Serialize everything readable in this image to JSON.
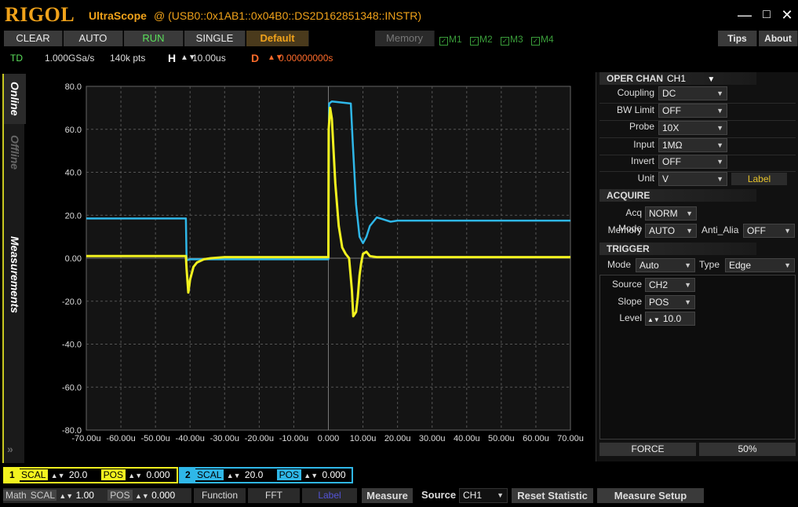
{
  "title": {
    "logo": "RIGOL",
    "app": "UltraScope",
    "instrument": "@ (USB0::0x1AB1::0x04B0::DS2D162851348::INSTR)"
  },
  "window_controls": {
    "minimize": "—",
    "maximize": "□",
    "close": "✕"
  },
  "toolbar": {
    "clear": "CLEAR",
    "auto": "AUTO",
    "run": "RUN",
    "single": "SINGLE",
    "default": "Default",
    "memory": "Memory",
    "m1": "M1",
    "m2": "M2",
    "m3": "M3",
    "m4": "M4",
    "tips": "Tips",
    "about": "About"
  },
  "info": {
    "td": "TD",
    "sample_rate": "1.000GSa/s",
    "points": "140k pts",
    "h_label": "H",
    "h_value": "10.00us",
    "d_label": "D",
    "d_value": "0.00000000s"
  },
  "left_tabs": {
    "online": "Online",
    "offline": "Offline",
    "measurements": "Measurements"
  },
  "chart_data": {
    "type": "line",
    "x_unit": "us",
    "xlim": [
      -70,
      70
    ],
    "ylim": [
      -80,
      80
    ],
    "grid": true,
    "x_ticks": [
      "-70.00u",
      "-60.00u",
      "-50.00u",
      "-40.00u",
      "-30.00u",
      "-20.00u",
      "-10.00u",
      "0.000",
      "10.00u",
      "20.00u",
      "30.00u",
      "40.00u",
      "50.00u",
      "60.00u",
      "70.00u"
    ],
    "y_ticks": [
      "80.0",
      "60.0",
      "40.0",
      "20.0",
      "0.00",
      "-20.0",
      "-40.0",
      "-60.0",
      "-80.0"
    ],
    "series": [
      {
        "color": "#2fb7e8",
        "x": [
          -70,
          -41.2,
          -41,
          -40,
          0,
          0.2,
          1,
          6.5,
          7,
          8,
          9,
          10,
          11,
          12,
          14,
          16,
          18,
          20,
          70
        ],
        "y": [
          18.5,
          18.5,
          -1,
          -0.5,
          -0.5,
          72,
          73,
          72,
          55,
          25,
          10,
          7,
          10,
          15,
          19,
          18,
          17,
          17.5,
          17.5
        ]
      },
      {
        "color": "#f2f21f",
        "x": [
          -70,
          -41.2,
          -41,
          -40.5,
          -40,
          -39,
          -38,
          -36,
          -34,
          -30,
          0,
          0.1,
          0.5,
          1,
          2,
          3,
          4,
          5,
          6,
          6.8,
          7.2,
          8,
          8.5,
          9,
          9.5,
          10,
          11,
          12,
          14,
          16,
          20,
          70
        ],
        "y": [
          1,
          1,
          -5,
          -16,
          -10,
          -4,
          -2,
          -0.5,
          0,
          0.5,
          0.5,
          60,
          70,
          65,
          35,
          15,
          5,
          2,
          0,
          -15,
          -27,
          -25,
          -18,
          -8,
          -2,
          2,
          3,
          1,
          0.5,
          0.5,
          0.5,
          0.5
        ]
      }
    ]
  },
  "oper_chan": {
    "header": "OPER CHAN",
    "channel": "CH1",
    "rows": [
      {
        "label": "Coupling",
        "value": "DC"
      },
      {
        "label": "BW Limit",
        "value": "OFF"
      },
      {
        "label": "Probe",
        "value": "10X"
      },
      {
        "label": "Input",
        "value": "1MΩ"
      },
      {
        "label": "Invert",
        "value": "OFF"
      },
      {
        "label": "Unit",
        "value": "V"
      }
    ],
    "label_btn": "Label"
  },
  "acquire": {
    "header": "ACQUIRE",
    "acq_mode_label": "Acq Mode",
    "acq_mode": "NORM",
    "memory_label": "Memory",
    "memory": "AUTO",
    "anti_alias_label": "Anti_Alia",
    "anti_alias": "OFF"
  },
  "trigger": {
    "header": "TRIGGER",
    "mode_label": "Mode",
    "mode": "Auto",
    "type_label": "Type",
    "type": "Edge",
    "source_label": "Source",
    "source": "CH2",
    "slope_label": "Slope",
    "slope": "POS",
    "level_label": "Level",
    "level": "10.0",
    "force": "FORCE",
    "fifty": "50%"
  },
  "ch1": {
    "num": "1",
    "scal_label": "SCAL",
    "scal": "20.0",
    "pos_label": "POS",
    "pos": "0.000"
  },
  "ch2": {
    "num": "2",
    "scal_label": "SCAL",
    "scal": "20.0",
    "pos_label": "POS",
    "pos": "0.000"
  },
  "math": {
    "math_label": "Math",
    "scal_label": "SCAL",
    "scal": "1.00",
    "pos_label": "POS",
    "pos": "0.000",
    "function": "Function",
    "fft": "FFT",
    "label": "Label"
  },
  "measure": {
    "measure": "Measure",
    "source_label": "Source",
    "source": "CH1",
    "reset": "Reset  Statistic",
    "setup": "Measure Setup"
  }
}
